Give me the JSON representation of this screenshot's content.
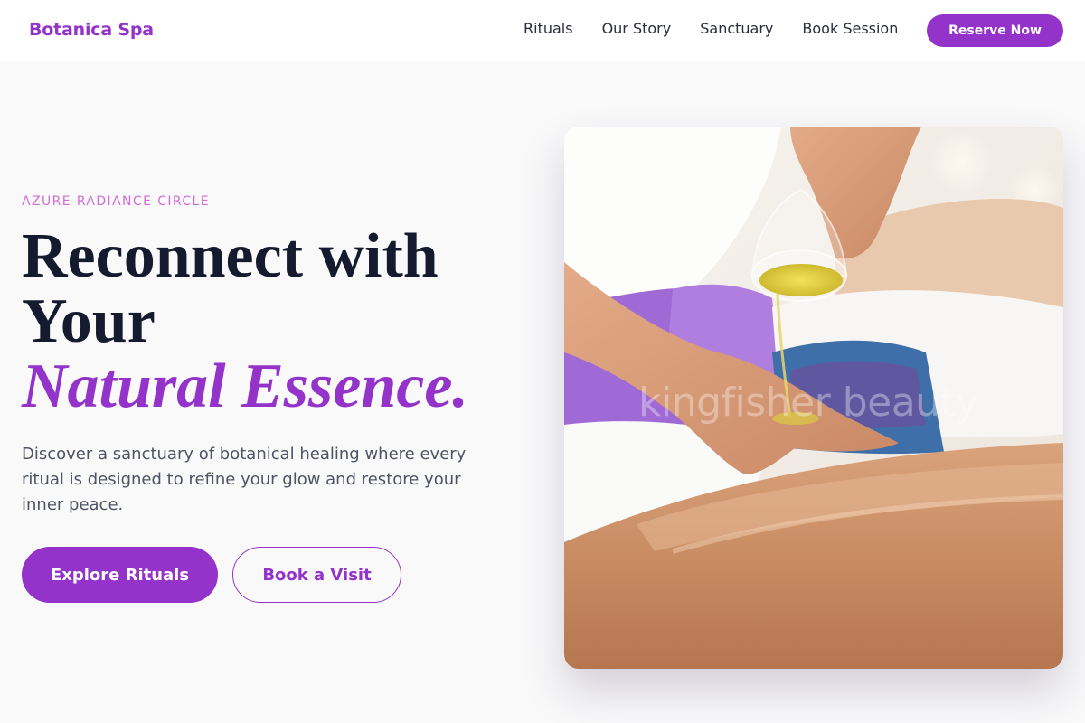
{
  "header": {
    "brand": "Botanica Spa",
    "nav": [
      "Rituals",
      "Our Story",
      "Sanctuary",
      "Book Session"
    ],
    "cta_label": "Reserve Now"
  },
  "hero": {
    "eyebrow": "AZURE RADIANCE CIRCLE",
    "headline_line1": "Reconnect with",
    "headline_line2": "Your",
    "headline_accent": "Natural Essence.",
    "lead": "Discover a sanctuary of botanical healing where every ritual is designed to refine your glow and restore your inner peace.",
    "primary_button": "Explore Rituals",
    "secondary_button": "Book a Visit",
    "image_watermark": "kingfisher beauty"
  },
  "colors": {
    "accent": "#9333c9",
    "eyebrow": "#cf6fd6",
    "heading": "#151a2e",
    "body_text": "#4f5363",
    "background": "#f9f9fa"
  }
}
